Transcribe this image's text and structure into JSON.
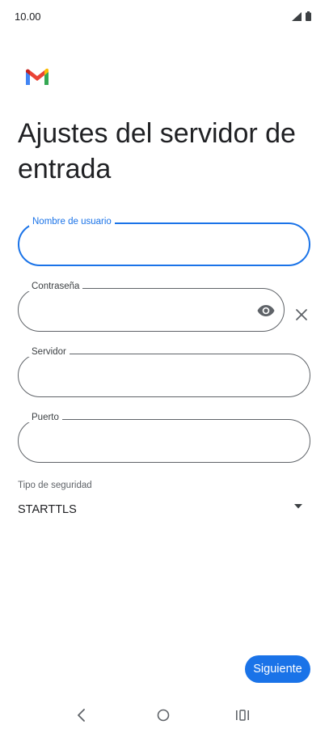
{
  "status_bar": {
    "time": "10.00"
  },
  "page": {
    "title": "Ajustes del servidor de entrada"
  },
  "fields": {
    "username": {
      "label": "Nombre de usuario",
      "value": ""
    },
    "password": {
      "label": "Contraseña",
      "value": ""
    },
    "server": {
      "label": "Servidor",
      "value": ""
    },
    "port": {
      "label": "Puerto",
      "value": ""
    }
  },
  "security": {
    "label": "Tipo de seguridad",
    "value": "STARTTLS"
  },
  "actions": {
    "next_label": "Siguiente"
  },
  "icons": {
    "app_logo": "gmail-logo",
    "password_visibility": "eye-icon",
    "clear": "close-icon",
    "dropdown": "arrow-drop-down-icon",
    "back": "back-icon",
    "home": "home-icon",
    "recents": "recents-icon"
  },
  "colors": {
    "accent": "#1a73e8",
    "text": "#202124",
    "border": "#5f6368"
  }
}
